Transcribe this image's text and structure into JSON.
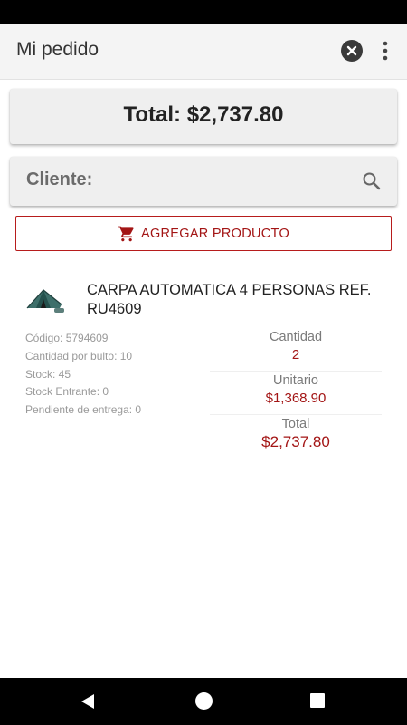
{
  "app_bar": {
    "title": "Mi pedido",
    "icons": [
      "close-circle-icon",
      "more-vert-icon"
    ]
  },
  "total": {
    "text": "Total: $2,737.80"
  },
  "client": {
    "label": "Cliente:",
    "icon": "search-icon"
  },
  "add_product": {
    "label": "AGREGAR PRODUCTO",
    "icon": "cart-icon"
  },
  "product": {
    "name": "CARPA AUTOMATICA 4 PERSONAS REF. RU4609",
    "image": "tent-thumbnail",
    "meta": [
      "Código: 5794609",
      "Cantidad por bulto: 10",
      "Stock: 45",
      "Stock Entrante: 0",
      "Pendiente de entrega: 0"
    ],
    "quantity_label": "Cantidad",
    "quantity_value": "2",
    "unit_label": "Unitario",
    "unit_value": "$1,368.90",
    "total_label": "Total",
    "total_value": "$2,737.80"
  },
  "navigation": {
    "icons": [
      "back-icon",
      "home-icon",
      "recent-apps-icon"
    ]
  },
  "colors": {
    "accent": "#a31515",
    "card": "#efefef",
    "app_bar": "#f4f4f4"
  }
}
